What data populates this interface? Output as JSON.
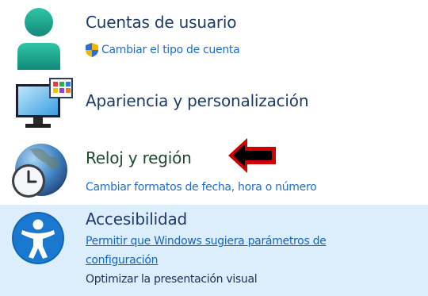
{
  "categories": [
    {
      "title": "Cuentas de usuario",
      "icon": "user-accounts-icon",
      "links": [
        "Cambiar el tipo de cuenta"
      ]
    },
    {
      "title": "Apariencia y personalización",
      "icon": "appearance-monitor-icon",
      "links": []
    },
    {
      "title": "Reloj y región",
      "icon": "clock-globe-icon",
      "links": [
        "Cambiar formatos de fecha, hora o número"
      ]
    },
    {
      "title": "Accesibilidad",
      "icon": "accessibility-icon",
      "links": [
        "Permitir que Windows sugiera parámetros de",
        "configuración",
        "Optimizar la presentación visual"
      ]
    }
  ],
  "colors": {
    "highlight_bg": "#dcedfb",
    "title_text": "#1e3a6c",
    "link_text": "#1a6ed6",
    "annotation_arrow": "#d10000"
  }
}
